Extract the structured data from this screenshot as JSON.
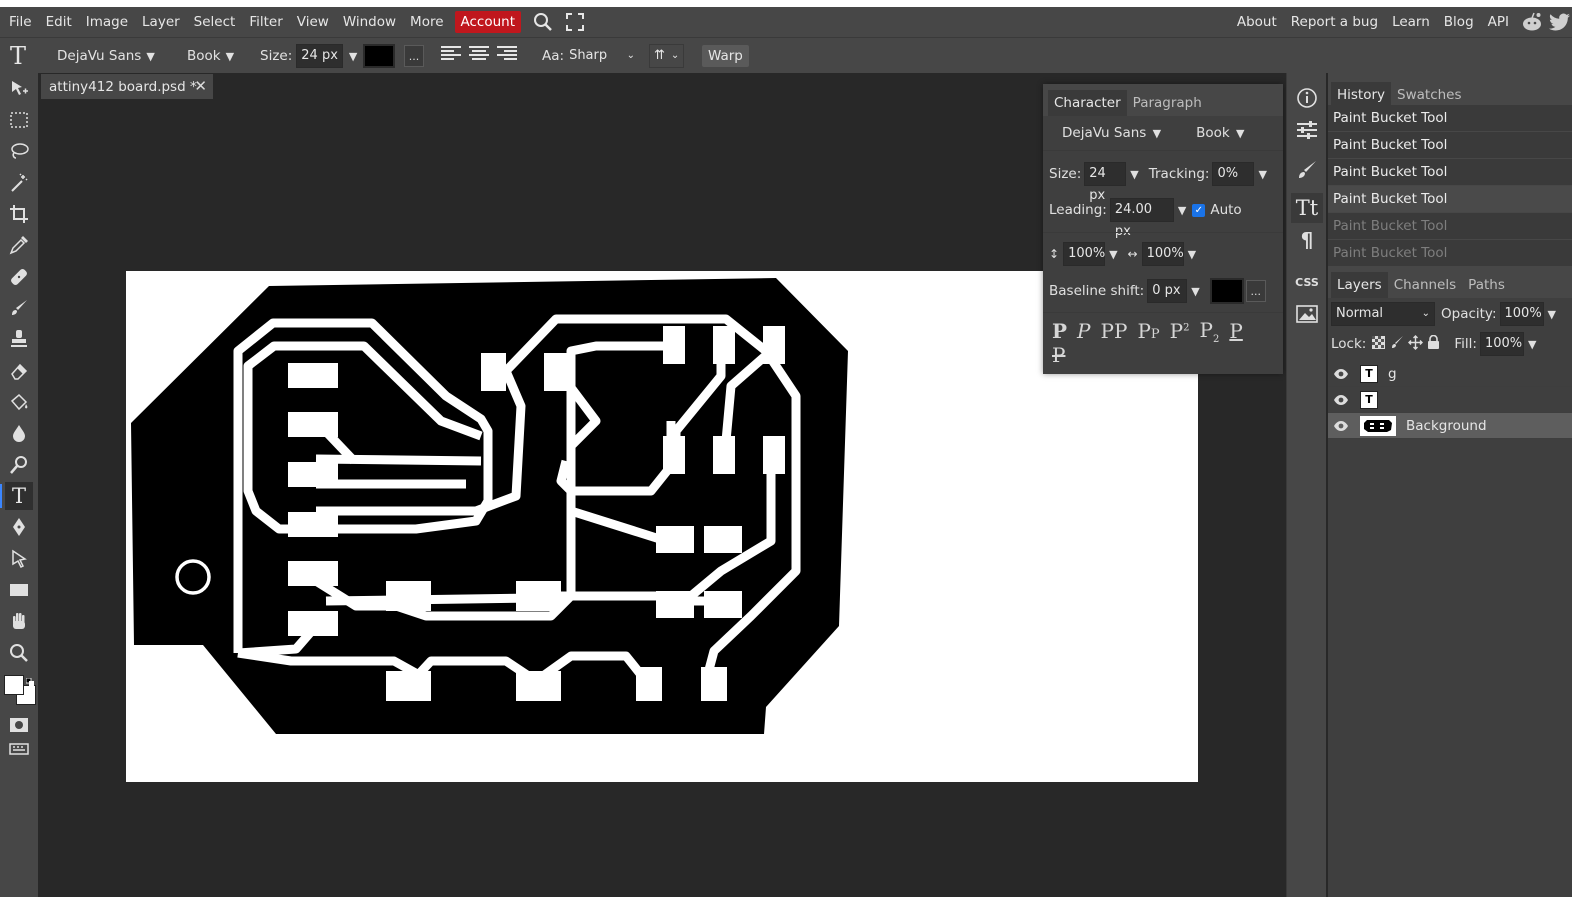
{
  "menubar": {
    "items": [
      "File",
      "Edit",
      "Image",
      "Layer",
      "Select",
      "Filter",
      "View",
      "Window",
      "More"
    ],
    "account": "Account",
    "right_links": [
      "About",
      "Report a bug",
      "Learn",
      "Blog",
      "API"
    ]
  },
  "options": {
    "font_family": "DejaVu Sans",
    "font_style": "Book",
    "size_label": "Size:",
    "size_value": "24 px",
    "color_hex": "#000000",
    "more": "...",
    "aa_label": "Aa:",
    "aa_value": "Sharp",
    "warp_label": "Warp"
  },
  "document": {
    "tab_title": "attiny412 board.psd *"
  },
  "character_panel": {
    "tabs": [
      "Character",
      "Paragraph"
    ],
    "font_family": "DejaVu Sans",
    "font_style": "Book",
    "size_label": "Size:",
    "size_value": "24 px",
    "tracking_label": "Tracking:",
    "tracking_value": "0%",
    "leading_label": "Leading:",
    "leading_value": "24.00 px",
    "auto_label": "Auto",
    "auto_checked": true,
    "vscale_value": "100%",
    "hscale_value": "100%",
    "baseline_label": "Baseline shift:",
    "baseline_value": "0 px",
    "more": "..."
  },
  "history": {
    "tabs": [
      "History",
      "Swatches"
    ],
    "items": [
      {
        "label": "Paint Bucket Tool",
        "active": true
      },
      {
        "label": "Paint Bucket Tool",
        "active": true
      },
      {
        "label": "Paint Bucket Tool",
        "active": true
      },
      {
        "label": "Paint Bucket Tool",
        "active": true
      },
      {
        "label": "Paint Bucket Tool",
        "active": false
      },
      {
        "label": "Paint Bucket Tool",
        "active": false
      }
    ]
  },
  "layers": {
    "tabs": [
      "Layers",
      "Channels",
      "Paths"
    ],
    "blend_mode": "Normal",
    "opacity_label": "Opacity:",
    "opacity_value": "100%",
    "lock_label": "Lock:",
    "fill_label": "Fill:",
    "fill_value": "100%",
    "items": [
      {
        "name": "g",
        "type": "text"
      },
      {
        "name": "",
        "type": "text"
      },
      {
        "name": "Background",
        "type": "image",
        "selected": true
      }
    ]
  },
  "colors": {
    "accent": "#3b86ff",
    "account_red": "#c0171d",
    "panel_bg": "#474747",
    "workspace_bg": "#282828"
  },
  "icons": {
    "menubar": [
      "search-icon",
      "fullscreen-icon",
      "reddit-icon",
      "twitter-icon"
    ],
    "tools": [
      "move-icon",
      "marquee-icon",
      "lasso-icon",
      "magic-wand-icon",
      "crop-icon",
      "eyedropper-icon",
      "healing-icon",
      "brush-icon",
      "stamp-icon",
      "eraser-icon",
      "paint-bucket-icon",
      "blur-icon",
      "dodge-icon",
      "type-icon",
      "pen-icon",
      "path-select-icon",
      "shape-icon",
      "hand-icon",
      "zoom-icon"
    ]
  }
}
